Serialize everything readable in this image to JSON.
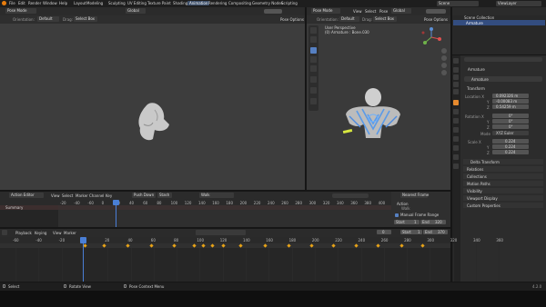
{
  "topbar": {
    "menus": [
      "File",
      "Edit",
      "Render",
      "Window",
      "Help"
    ],
    "workspaces": [
      "Layout",
      "Modeling",
      "Sculpting",
      "UV Editing",
      "Texture Paint",
      "Shading",
      "Animation",
      "Rendering",
      "Compositing",
      "Geometry Nodes",
      "Scripting"
    ],
    "active_workspace": "Animation",
    "scene": "Scene",
    "view_layer": "ViewLayer"
  },
  "left_view": {
    "mode": "Pose Mode",
    "orientation_label": "Orientation:",
    "orientation": "Default",
    "drag_label": "Drag:",
    "drag": "Select Box",
    "transform": "Global",
    "pose_options": "Pose Options"
  },
  "right_view": {
    "mode": "Pose Mode",
    "menus": [
      "View",
      "Select",
      "Pose"
    ],
    "transform": "Global",
    "perspective": "User Perspective",
    "object_info": "(0) Armature : Bone.030",
    "orientation_label": "Orientation:",
    "orientation": "Default",
    "drag_label": "Drag:",
    "drag": "Select Box",
    "pose_options": "Pose Options"
  },
  "outliner": {
    "title": "Scene Collection",
    "item": "Armature"
  },
  "properties": {
    "object": "Armature",
    "subobject": "Armature",
    "transform": "Transform",
    "location_label": "Location X",
    "location": [
      "0.092326 m",
      "-0.00083 m",
      "0.54259 m"
    ],
    "rotation_label": "Rotation X",
    "rotation": [
      "0°",
      "0°",
      "0°"
    ],
    "mode_label": "Mode",
    "mode": "XYZ Euler",
    "scale_label": "Scale X",
    "scale": [
      "0.224",
      "0.224",
      "0.224"
    ],
    "axis_y": "Y",
    "axis_z": "Z",
    "sections": [
      "Delta Transform",
      "Relations",
      "Collections",
      "Motion Paths",
      "Visibility",
      "Viewport Display",
      "Custom Properties"
    ]
  },
  "action_editor": {
    "mode": "Action Editor",
    "menus": [
      "View",
      "Select",
      "Marker",
      "Channel",
      "Key"
    ],
    "push_down": "Push Down",
    "stash": "Stash",
    "action": "Walk",
    "summary": "Summary",
    "frame_ticks": [
      "-20",
      "-40",
      "-60",
      "0",
      "20",
      "40",
      "60",
      "80",
      "100",
      "120",
      "140",
      "160",
      "180",
      "200",
      "220",
      "240",
      "260",
      "280",
      "300",
      "320",
      "340",
      "360",
      "380",
      "400",
      "420"
    ],
    "current_frame": "0"
  },
  "action_panel": {
    "title": "Nearest Frame",
    "section": "Action",
    "slot": "Walk",
    "manual_range": "Manual Frame Range",
    "start_label": "Start",
    "start": "1",
    "end_label": "End",
    "end": "320"
  },
  "timeline": {
    "playback": "Playback",
    "keying": "Keying",
    "menus": [
      "View",
      "Marker"
    ],
    "current_frame": "0",
    "start_label": "Start",
    "start": "1",
    "end_label": "End",
    "end": "370",
    "frame_ticks": [
      "-60",
      "-40",
      "-20",
      "0",
      "20",
      "40",
      "60",
      "80",
      "100",
      "120",
      "140",
      "160",
      "180",
      "200",
      "220",
      "240",
      "260",
      "280",
      "300",
      "320",
      "340",
      "360"
    ]
  },
  "statusbar": {
    "select": "Select",
    "rotate": "Rotate View",
    "context": "Pose Context Menu",
    "version": "4.2.0"
  },
  "colors": {
    "accent": "#5680c2",
    "playhead": "#4a7fd6",
    "keyframe": "#e8a317",
    "active_tab": "#3d4f6a"
  }
}
